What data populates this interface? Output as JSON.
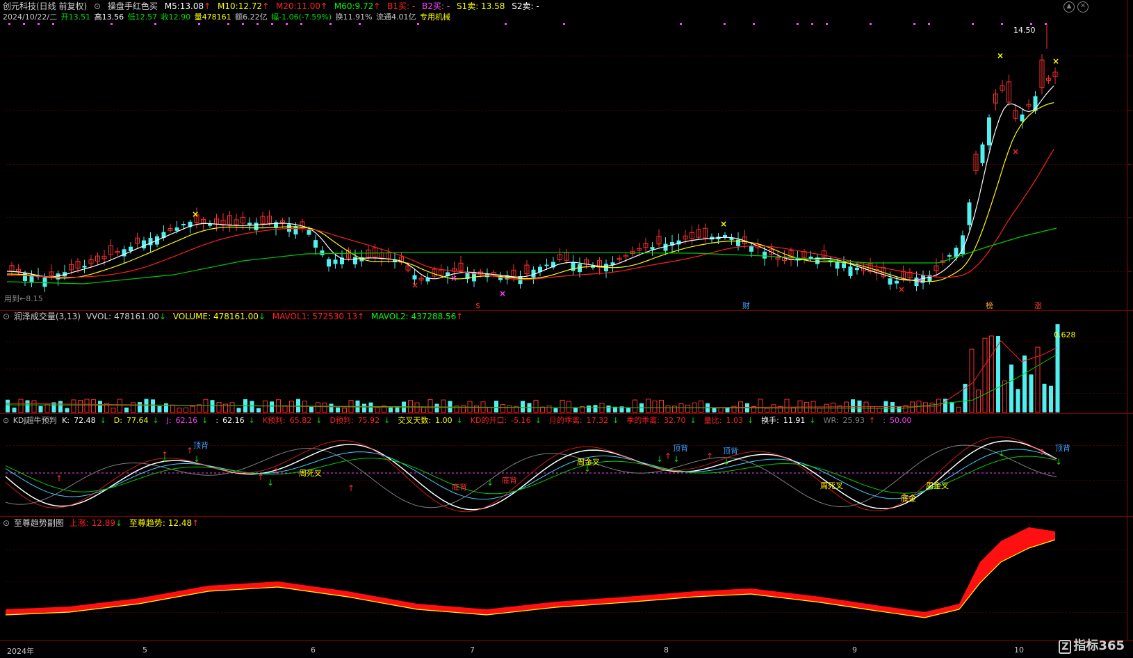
{
  "main": {
    "stock": "创元科技(日线 前复权)",
    "indicator": "操盘手红色买",
    "ma": [
      {
        "label": "M5:",
        "value": "13.08",
        "arrow": "↑",
        "color": "#ffffff"
      },
      {
        "label": "M10:",
        "value": "12.72",
        "arrow": "↑",
        "color": "#ffff00"
      },
      {
        "label": "M20:",
        "value": "11.00",
        "arrow": "↑",
        "color": "#ff2020"
      },
      {
        "label": "M60:",
        "value": "9.72",
        "arrow": "↑",
        "color": "#00ff00"
      }
    ],
    "signals": [
      "B1买: -",
      "B2买: -",
      "S1卖: 13.58",
      "S2卖: -"
    ],
    "quote_line": {
      "date": "2024/10/22/二",
      "open": "开13.51",
      "high": "高13.56",
      "low": "低12.57",
      "close": "收12.90",
      "vol": "量478161",
      "amount": "额6.22亿",
      "change": "幅-1.06(-7.59%)",
      "turnover": "换11.91%",
      "float": "流通4.01亿",
      "sector": "专用机械"
    },
    "price_high_label": "14.50",
    "low_label": "用到←8.15",
    "event_tags": [
      "$",
      "财",
      "榜",
      "涨"
    ],
    "buy_mark_color": "#ff2020",
    "sell_mark_color": "#ffff00"
  },
  "volume_panel": {
    "title": "润泽成交量(3,13)",
    "items": [
      {
        "label": "VVOL:",
        "value": "478161.00",
        "arrow": "↓"
      },
      {
        "label": "VOLUME:",
        "value": "478161.00",
        "arrow": "↓"
      },
      {
        "label": "MAVOL1:",
        "value": "572530.13",
        "arrow": "↑"
      },
      {
        "label": "MAVOL2:",
        "value": "437288.56",
        "arrow": "↑"
      }
    ],
    "ratio_label": "0.628"
  },
  "kdj_panel": {
    "title": "KDJ超牛预判",
    "items": [
      {
        "label": "K:",
        "value": "72.48",
        "arrow": "↓",
        "color": "#ffffff"
      },
      {
        "label": "D:",
        "value": "77.64",
        "arrow": "↓",
        "color": "#ffff00"
      },
      {
        "label": "J:",
        "value": "62.16",
        "arrow": "↓",
        "color": "#ff40ff"
      },
      {
        "label": ":",
        "value": "62.16",
        "arrow": "↓",
        "color": "#ffffff"
      },
      {
        "label": "K预判:",
        "value": "65.82",
        "arrow": "↓",
        "color": "#ff2020"
      },
      {
        "label": "D预判:",
        "value": "75.92",
        "arrow": "↓",
        "color": "#ff2020"
      },
      {
        "label": "交叉天数:",
        "value": "1.00",
        "arrow": "↓",
        "color": "#ffff00"
      },
      {
        "label": "KD的开口:",
        "value": "-5.16",
        "arrow": "↓",
        "color": "#ff2020"
      },
      {
        "label": "月的乖离:",
        "value": "17.32",
        "arrow": "↓",
        "color": "#ff2020"
      },
      {
        "label": "季的乖离:",
        "value": "32.70",
        "arrow": "↓",
        "color": "#ff2020"
      },
      {
        "label": "量比:",
        "value": "1.03",
        "arrow": "↓",
        "color": "#ff2020"
      },
      {
        "label": "换手:",
        "value": "11.91",
        "arrow": "↓",
        "color": "#ffffff"
      },
      {
        "label": "WR:",
        "value": "25.93",
        "arrow": "↑",
        "color": "#808080"
      },
      {
        "label": ":",
        "value": "50.00",
        "arrow": "",
        "color": "#ff40ff"
      }
    ],
    "annotations": [
      "顶背",
      "周死叉",
      "底背",
      "底背",
      "周金叉",
      "顶背",
      "顶背",
      "周死叉",
      "底金",
      "周金叉",
      "顶背"
    ]
  },
  "trend_panel": {
    "title": "至尊趋势副图",
    "items": [
      {
        "label": "上涨:",
        "value": "12.89",
        "arrow": "↓",
        "color": "#ff2020"
      },
      {
        "label": "至尊趋势:",
        "value": "12.48",
        "arrow": "↑",
        "color": "#ffff00"
      }
    ]
  },
  "x_axis": [
    "2024年",
    "5",
    "6",
    "7",
    "8",
    "9",
    "10"
  ],
  "brand": "指标365"
}
